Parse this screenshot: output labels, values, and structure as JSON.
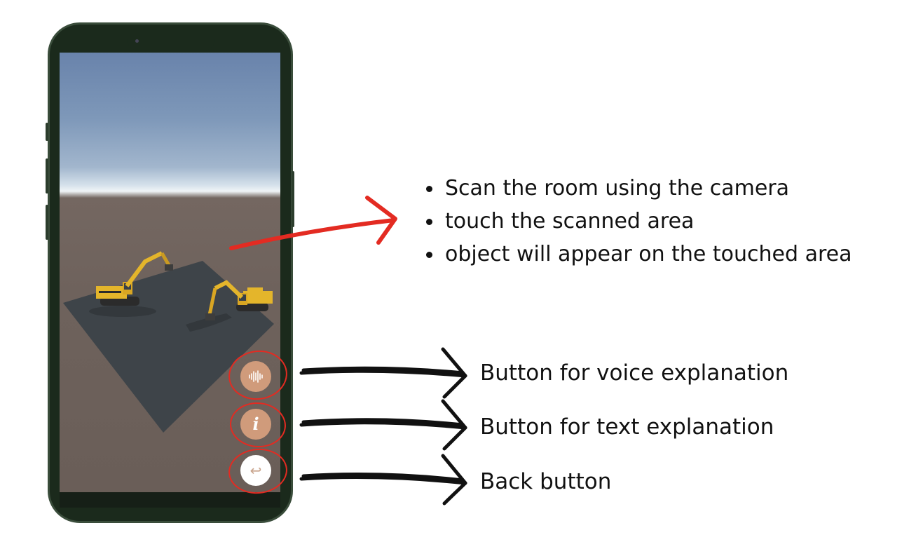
{
  "instructions": [
    "Scan the room using the camera",
    "touch the scanned area",
    "object will appear on the touched area"
  ],
  "callouts": {
    "voice": "Button for voice explanation",
    "text": "Button for text explanation",
    "back": "Back button"
  },
  "buttons": {
    "voice_icon": "waveform-icon",
    "info_icon": "info-icon",
    "back_icon": "undo-arrow-icon",
    "info_glyph": "i",
    "back_glyph": "↩"
  },
  "colors": {
    "accent_button": "#d09b7b",
    "highlight_ring": "#e32b22",
    "excavator": "#e4b52b"
  }
}
